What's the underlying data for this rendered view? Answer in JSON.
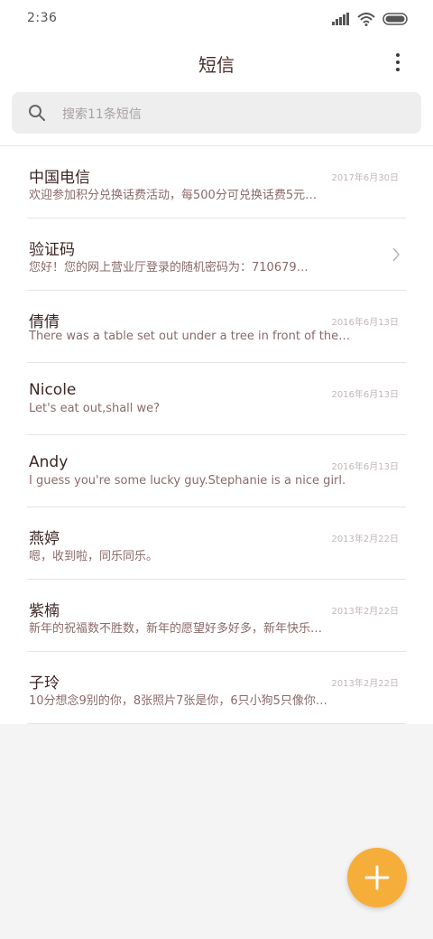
{
  "status_bar": {
    "time": "2:36",
    "icons": [
      "signal-icon",
      "wifi-icon",
      "battery-icon"
    ]
  },
  "app_bar": {
    "title": "短信",
    "menu_icon": "more-vertical-icon"
  },
  "search": {
    "placeholder": "搜索11条短信",
    "icon": "search-icon"
  },
  "conversations": [
    {
      "name": "中国电信",
      "date": "2017年6月30日",
      "preview": "欢迎参加积分兑换话费活动，每500分可兑换话费5元…",
      "has_chevron": false
    },
    {
      "name": "验证码",
      "date": "",
      "preview": "您好！您的网上营业厅登录的随机密码为：710679…",
      "has_chevron": true
    },
    {
      "name": "倩倩",
      "date": "2016年6月13日",
      "preview": "There was a table set out under a tree in front of the house…",
      "has_chevron": false
    },
    {
      "name": "Nicole",
      "date": "2016年6月13日",
      "preview": "Let's eat out,shall we?",
      "has_chevron": false
    },
    {
      "name": "Andy",
      "date": "2016年6月13日",
      "preview": "I guess you're some lucky guy.Stephanie is a nice girl.",
      "has_chevron": false
    },
    {
      "name": "燕婷",
      "date": "2013年2月22日",
      "preview": "嗯，收到啦，同乐同乐。",
      "has_chevron": false
    },
    {
      "name": "紫楠",
      "date": "2013年2月22日",
      "preview": "新年的祝福数不胜数，新年的愿望好多好多，新年快乐…",
      "has_chevron": false
    },
    {
      "name": "子玲",
      "date": "2013年2月22日",
      "preview": "10分想念9别的你，8张照片7张是你，6只小狗5只像你…",
      "has_chevron": false
    }
  ],
  "fab": {
    "icon": "plus-icon",
    "color": "#f6ae3a"
  },
  "colors": {
    "accent": "#f6ae3a",
    "title_text": "#4a2d2d",
    "preview_text": "#8a6a6a",
    "date_text": "#c2b8b8"
  }
}
